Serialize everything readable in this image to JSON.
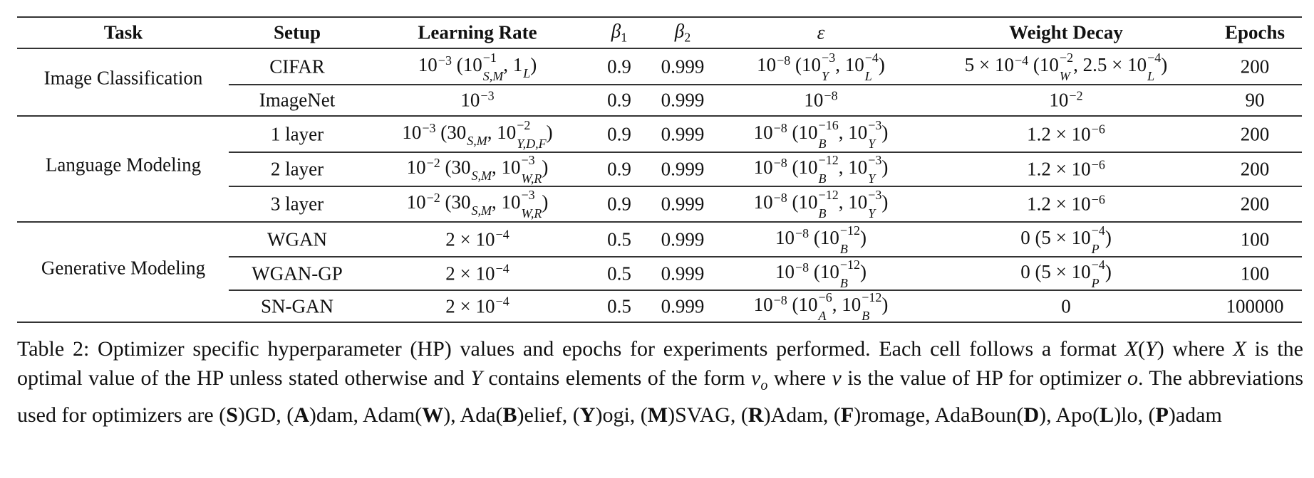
{
  "table": {
    "headers": [
      "Task",
      "Setup",
      "Learning Rate",
      "β",
      "β",
      "ε",
      "Weight Decay",
      "Epochs"
    ],
    "header_subs": [
      "",
      "",
      "",
      "1",
      "2",
      "",
      "",
      ""
    ],
    "groups": [
      {
        "task": "Image Classification",
        "rows": [
          0,
          1
        ]
      },
      {
        "task": "Language Modeling",
        "rows": [
          2,
          3,
          4
        ]
      },
      {
        "task": "Generative Modeling",
        "rows": [
          5,
          6,
          7
        ]
      }
    ],
    "rows": [
      {
        "setup": "CIFAR",
        "lr": [
          [
            "10",
            "−3",
            ""
          ],
          " (",
          [
            "10",
            "−1",
            "S,M"
          ],
          ", ",
          [
            "1",
            "",
            "L"
          ],
          ")"
        ],
        "beta1": "0.9",
        "beta2": "0.999",
        "eps": [
          [
            "10",
            "−8",
            ""
          ],
          " (",
          [
            "10",
            "−3",
            "Y"
          ],
          ", ",
          [
            "10",
            "−4",
            "L"
          ],
          ")"
        ],
        "wd": [
          "5 × ",
          [
            "10",
            "−4",
            ""
          ],
          " (",
          [
            "10",
            "−2",
            "W"
          ],
          ", 2.5 × ",
          [
            "10",
            "−4",
            "L"
          ],
          ")"
        ],
        "epochs": "200"
      },
      {
        "setup": "ImageNet",
        "lr": [
          [
            "10",
            "−3",
            ""
          ]
        ],
        "beta1": "0.9",
        "beta2": "0.999",
        "eps": [
          [
            "10",
            "−8",
            ""
          ]
        ],
        "wd": [
          [
            "10",
            "−2",
            ""
          ]
        ],
        "epochs": "90"
      },
      {
        "setup": "1 layer",
        "lr": [
          [
            "10",
            "−3",
            ""
          ],
          " (",
          [
            "30",
            "",
            "S,M"
          ],
          ", ",
          [
            "10",
            "−2",
            "Y,D,F"
          ],
          ")"
        ],
        "beta1": "0.9",
        "beta2": "0.999",
        "eps": [
          [
            "10",
            "−8",
            ""
          ],
          " (",
          [
            "10",
            "−16",
            "B"
          ],
          ", ",
          [
            "10",
            "−3",
            "Y"
          ],
          ")"
        ],
        "wd": [
          "1.2 × ",
          [
            "10",
            "−6",
            ""
          ]
        ],
        "epochs": "200"
      },
      {
        "setup": "2 layer",
        "lr": [
          [
            "10",
            "−2",
            ""
          ],
          " (",
          [
            "30",
            "",
            "S,M"
          ],
          ", ",
          [
            "10",
            "−3",
            "W,R"
          ],
          ")"
        ],
        "beta1": "0.9",
        "beta2": "0.999",
        "eps": [
          [
            "10",
            "−8",
            ""
          ],
          " (",
          [
            "10",
            "−12",
            "B"
          ],
          ", ",
          [
            "10",
            "−3",
            "Y"
          ],
          ")"
        ],
        "wd": [
          "1.2 × ",
          [
            "10",
            "−6",
            ""
          ]
        ],
        "epochs": "200"
      },
      {
        "setup": "3 layer",
        "lr": [
          [
            "10",
            "−2",
            ""
          ],
          " (",
          [
            "30",
            "",
            "S,M"
          ],
          ", ",
          [
            "10",
            "−3",
            "W,R"
          ],
          ")"
        ],
        "beta1": "0.9",
        "beta2": "0.999",
        "eps": [
          [
            "10",
            "−8",
            ""
          ],
          " (",
          [
            "10",
            "−12",
            "B"
          ],
          ", ",
          [
            "10",
            "−3",
            "Y"
          ],
          ")"
        ],
        "wd": [
          "1.2 × ",
          [
            "10",
            "−6",
            ""
          ]
        ],
        "epochs": "200"
      },
      {
        "setup": "WGAN",
        "lr": [
          "2 × ",
          [
            "10",
            "−4",
            ""
          ]
        ],
        "beta1": "0.5",
        "beta2": "0.999",
        "eps": [
          [
            "10",
            "−8",
            ""
          ],
          " (",
          [
            "10",
            "−12",
            "B"
          ],
          ")"
        ],
        "wd": [
          "0 (5 × ",
          [
            "10",
            "−4",
            "P"
          ],
          ")"
        ],
        "epochs": "100"
      },
      {
        "setup": "WGAN-GP",
        "lr": [
          "2 × ",
          [
            "10",
            "−4",
            ""
          ]
        ],
        "beta1": "0.5",
        "beta2": "0.999",
        "eps": [
          [
            "10",
            "−8",
            ""
          ],
          " (",
          [
            "10",
            "−12",
            "B"
          ],
          ")"
        ],
        "wd": [
          "0 (5 × ",
          [
            "10",
            "−4",
            "P"
          ],
          ")"
        ],
        "epochs": "100"
      },
      {
        "setup": "SN-GAN",
        "lr": [
          "2 × ",
          [
            "10",
            "−4",
            ""
          ]
        ],
        "beta1": "0.5",
        "beta2": "0.999",
        "eps": [
          [
            "10",
            "−8",
            ""
          ],
          " (",
          [
            "10",
            "−6",
            "A"
          ],
          ", ",
          [
            "10",
            "−12",
            "B"
          ],
          ")"
        ],
        "wd": [
          "0"
        ],
        "epochs": "100000"
      }
    ]
  },
  "caption": [
    "Table 2: Optimizer specific hyperparameter (HP) values and epochs for experiments performed. Each cell follows a format ",
    {
      "i": "X"
    },
    "(",
    {
      "i": "Y"
    },
    ") where ",
    {
      "i": "X"
    },
    " is the optimal value of the HP unless stated otherwise and ",
    {
      "i": "Y"
    },
    " contains elements of the form ",
    {
      "i": "v",
      "sub": "o"
    },
    " where ",
    {
      "i": "v"
    },
    " is the value of HP for optimizer ",
    {
      "i": "o"
    },
    ". The abbreviations used for optimizers are (",
    {
      "b": "S"
    },
    ")GD, (",
    {
      "b": "A"
    },
    ")dam, Adam(",
    {
      "b": "W"
    },
    "), Ada(",
    {
      "b": "B"
    },
    ")elief, (",
    {
      "b": "Y"
    },
    ")ogi, (",
    {
      "b": "M"
    },
    ")SVAG, (",
    {
      "b": "R"
    },
    ")Adam, (",
    {
      "b": "F"
    },
    ")romage, AdaBoun(",
    {
      "b": "D"
    },
    "), Apo(",
    {
      "b": "L"
    },
    ")lo, (",
    {
      "b": "P"
    },
    ")adam"
  ]
}
